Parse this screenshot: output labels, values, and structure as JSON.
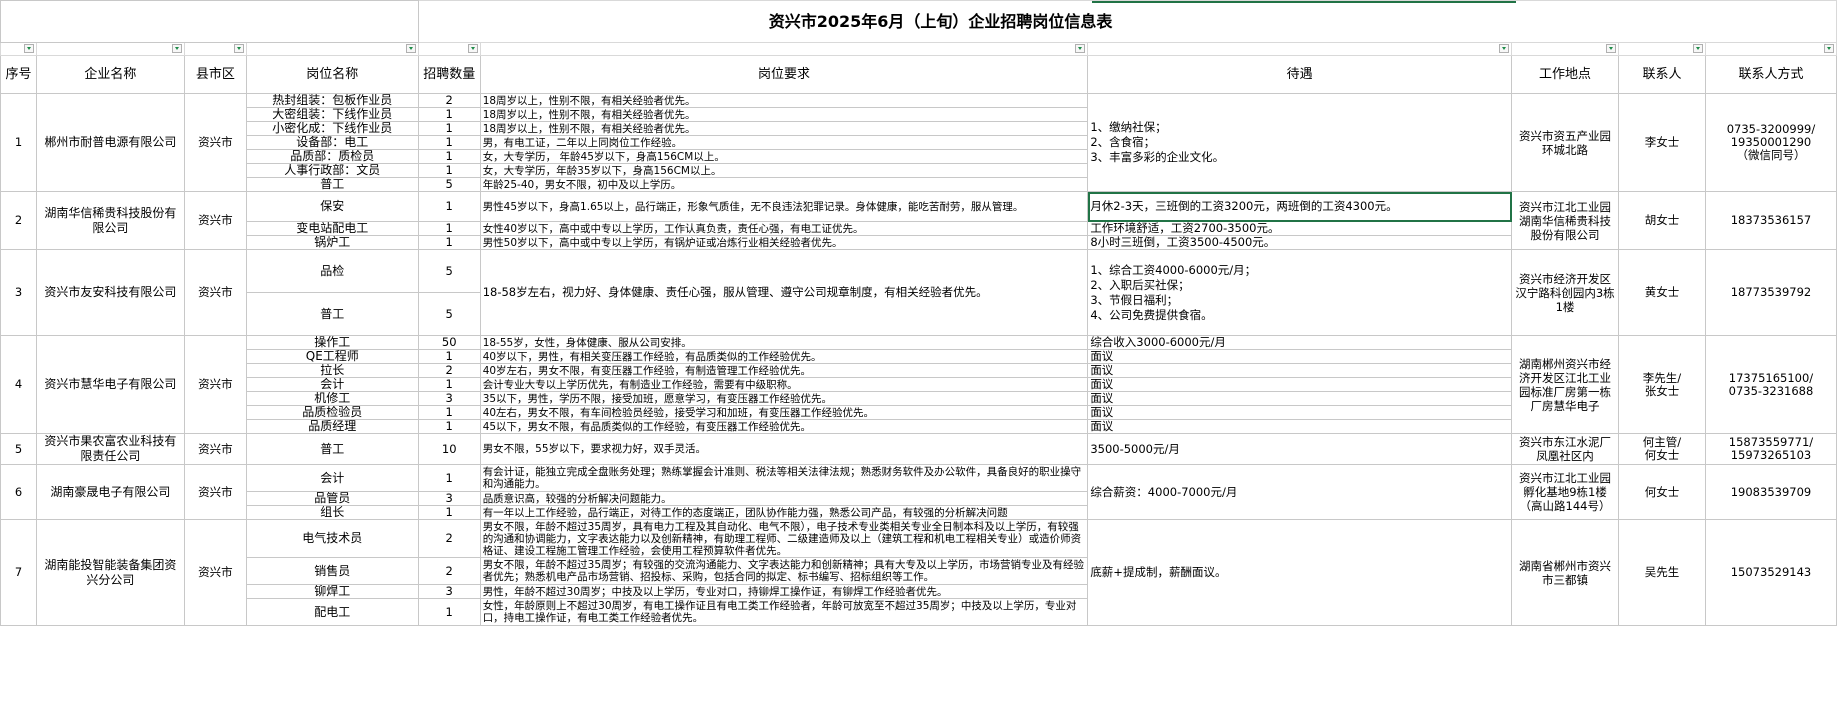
{
  "sheet": {
    "title": "资兴市2025年6月（上旬）企业招聘岗位信息表",
    "headers": [
      "序号",
      "企业名称",
      "县市区",
      "岗位名称",
      "招聘数量",
      "岗位要求",
      "待遇",
      "工作地点",
      "联系人",
      "联系人方式"
    ]
  },
  "companies": [
    {
      "no": "1",
      "name": "郴州市耐普电源有限公司",
      "district": "资兴市",
      "benefits": "1、缴纳社保；\n2、含食宿；\n3、丰富多彩的企业文化。",
      "location": "资兴市资五产业园环城北路",
      "contact": "李女士",
      "phone": "0735-3200999/\n19350001290\n（微信同号）",
      "jobs": [
        {
          "title": "热封组装：包板作业员",
          "count": "2",
          "req": "18周岁以上，性别不限，有相关经验者优先。"
        },
        {
          "title": "大密组装：下线作业员",
          "count": "1",
          "req": "18周岁以上，性别不限，有相关经验者优先。"
        },
        {
          "title": "小密化成：下线作业员",
          "count": "1",
          "req": "18周岁以上，性别不限，有相关经验者优先。"
        },
        {
          "title": "设备部：电工",
          "count": "1",
          "req": "男，有电工证，二年以上同岗位工作经验。"
        },
        {
          "title": "品质部：质检员",
          "count": "1",
          "req": "女，大专学历， 年龄45岁以下，身高156CM以上。"
        },
        {
          "title": "人事行政部：文员",
          "count": "1",
          "req": "女，大专学历，年龄35岁以下，身高156CM以上。"
        },
        {
          "title": "普工",
          "count": "5",
          "req": "年龄25-40，男女不限，初中及以上学历。"
        }
      ]
    },
    {
      "no": "2",
      "name": "湖南华信稀贵科技股份有限公司",
      "district": "资兴市",
      "location": "资兴市江北工业园湖南华信稀贵科技股份有限公司",
      "contact": "胡女士",
      "phone": "18373536157",
      "jobs": [
        {
          "title": "保安",
          "count": "1",
          "req": "男性45岁以下，身高1.65以上，品行端正，形象气质佳，无不良违法犯罪记录。身体健康，能吃苦耐劳，服从管理。",
          "benefit": "月休2-3天，三班倒的工资3200元，两班倒的工资4300元。"
        },
        {
          "title": "变电站配电工",
          "count": "1",
          "req": "女性40岁以下，高中或中专以上学历，工作认真负责，责任心强，有电工证优先。",
          "benefit": "工作环境舒适，工资2700-3500元。"
        },
        {
          "title": "锅炉工",
          "count": "1",
          "req": "男性50岁以下，高中或中专以上学历，有锅炉证或冶炼行业相关经验者优先。",
          "benefit": "8小时三班倒，工资3500-4500元。"
        }
      ]
    },
    {
      "no": "3",
      "name": "资兴市友安科技有限公司",
      "district": "资兴市",
      "req": "18-58岁左右，视力好、身体健康、责任心强，服从管理、遵守公司规章制度，有相关经验者优先。",
      "benefits": "1、综合工资4000-6000元/月；\n2、入职后买社保；\n3、节假日福利；\n4、公司免费提供食宿。",
      "location": "资兴市经济开发区汉宁路科创园内3栋1楼",
      "contact": "黄女士",
      "phone": "18773539792",
      "jobs": [
        {
          "title": "品检",
          "count": "5"
        },
        {
          "title": "普工",
          "count": "5"
        }
      ]
    },
    {
      "no": "4",
      "name": "资兴市慧华电子有限公司",
      "district": "资兴市",
      "location": "湖南郴州资兴市经济开发区江北工业园标准厂房第一栋厂房慧华电子",
      "contact": "李先生/\n张女士",
      "phone": "17375165100/\n0735-3231688",
      "jobs": [
        {
          "title": "操作工",
          "count": "50",
          "req": "18-55岁，女性，身体健康、服从公司安排。",
          "benefit": "综合收入3000-6000元/月"
        },
        {
          "title": "QE工程师",
          "count": "1",
          "req": "40岁以下，男性，有相关变压器工作经验，有品质类似的工作经验优先。",
          "benefit": "面议"
        },
        {
          "title": "拉长",
          "count": "2",
          "req": "40岁左右，男女不限，有变压器工作经验，有制造管理工作经验优先。",
          "benefit": "面议"
        },
        {
          "title": "会计",
          "count": "1",
          "req": "会计专业大专以上学历优先，有制造业工作经验，需要有中级职称。",
          "benefit": "面议"
        },
        {
          "title": "机修工",
          "count": "3",
          "req": "35以下，男性，学历不限，接受加班，愿意学习，有变压器工作经验优先。",
          "benefit": "面议"
        },
        {
          "title": "品质检验员",
          "count": "1",
          "req": "40左右，男女不限，有车间检验员经验，接受学习和加班，有变压器工作经验优先。",
          "benefit": "面议"
        },
        {
          "title": "品质经理",
          "count": "1",
          "req": "45以下，男女不限，有品质类似的工作经验，有变压器工作经验优先。",
          "benefit": "面议"
        }
      ]
    },
    {
      "no": "5",
      "name": "资兴市果农富农业科技有限责任公司",
      "district": "资兴市",
      "location": "资兴市东江水泥厂凤凰社区内",
      "contact": "何主管/\n何女士",
      "phone": "15873559771/\n15973265103",
      "jobs": [
        {
          "title": "普工",
          "count": "10",
          "req": "男女不限，55岁以下，要求视力好，双手灵活。",
          "benefit": "3500-5000元/月"
        }
      ]
    },
    {
      "no": "6",
      "name": "湖南豪晟电子有限公司",
      "district": "资兴市",
      "benefits": "综合薪资：4000-7000元/月",
      "location": "资兴市江北工业园孵化基地9栋1楼（高山路144号）",
      "contact": "何女士",
      "phone": "19083539709",
      "jobs": [
        {
          "title": "会计",
          "count": "1",
          "req": "有会计证，能独立完成全盘账务处理；熟练掌握会计准则、税法等相关法律法规；熟悉财务软件及办公软件，具备良好的职业操守和沟通能力。"
        },
        {
          "title": "品管员",
          "count": "3",
          "req": "品质意识高，较强的分析解决问题能力。"
        },
        {
          "title": "组长",
          "count": "1",
          "req": "有一年以上工作经验，品行端正，对待工作的态度端正，团队协作能力强，熟悉公司产品，有较强的分析解决问题"
        }
      ]
    },
    {
      "no": "7",
      "name": "湖南能投智能装备集团资兴分公司",
      "district": "资兴市",
      "benefits": "底薪+提成制，薪酬面议。",
      "location": "湖南省郴州市资兴市三都镇",
      "contact": "吴先生",
      "phone": "15073529143",
      "jobs": [
        {
          "title": "电气技术员",
          "count": "2",
          "req": "男女不限，年龄不超过35周岁，具有电力工程及其自动化、电气不限），电子技术专业类相关专业全日制本科及以上学历，有较强的沟通和协调能力，文字表达能力以及创新精神，有助理工程师、二级建造师及以上（建筑工程和机电工程相关专业）或造价师资格证、建设工程施工管理工作经验，会使用工程预算软件者优先。"
        },
        {
          "title": "销售员",
          "count": "2",
          "req": "男女不限，年龄不超过35周岁；有较强的交流沟通能力、文字表达能力和创新精神；具有大专及以上学历，市场营销专业及有经验者优先；熟悉机电产品市场营销、招投标、采购，包括合同的拟定、标书编写、招标组织等工作。"
        },
        {
          "title": "铆焊工",
          "count": "3",
          "req": "男性，年龄不超过30周岁；中技及以上学历，专业对口，持铆焊工操作证，有铆焊工作经验者优先。"
        },
        {
          "title": "配电工",
          "count": "1",
          "req": "女性，年龄原则上不超过30周岁，有电工操作证且有电工类工作经验者，年龄可放宽至不超过35周岁；中技及以上学历，专业对口，持电工操作证，有电工类工作经验者优先。"
        }
      ]
    }
  ]
}
